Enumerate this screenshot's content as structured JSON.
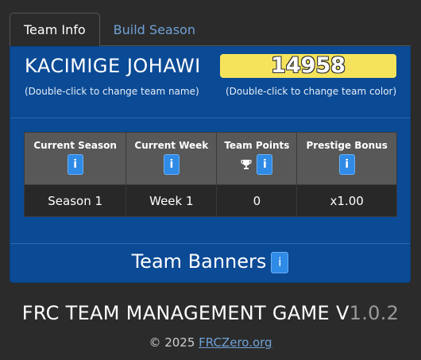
{
  "tabs": [
    {
      "label": "Team Info",
      "active": true
    },
    {
      "label": "Build Season",
      "active": false
    }
  ],
  "team": {
    "name": "KACIMIGE JOHAWI",
    "name_hint": "(Double-click to change team name)",
    "number": "14958",
    "color": "#f5e45b",
    "color_hint": "(Double-click to change team color)"
  },
  "stats": {
    "headers": [
      "Current Season",
      "Current Week",
      "Team Points",
      "Prestige Bonus"
    ],
    "values": [
      "Season 1",
      "Week 1",
      "0",
      "x1.00"
    ],
    "info_icon": "i"
  },
  "banners": {
    "label": "Team Banners",
    "info_icon": "i"
  },
  "footer": {
    "title_main": "FRC TEAM MANAGEMENT GAME V",
    "title_version": "1.0.2",
    "copyright": "© 2025 ",
    "link": "FRCZero.org"
  },
  "colors": {
    "background": "#2b2b2b",
    "panel": "#0b4a95",
    "accent_link": "#6fa2d6",
    "info_button": "#2f8be6"
  }
}
